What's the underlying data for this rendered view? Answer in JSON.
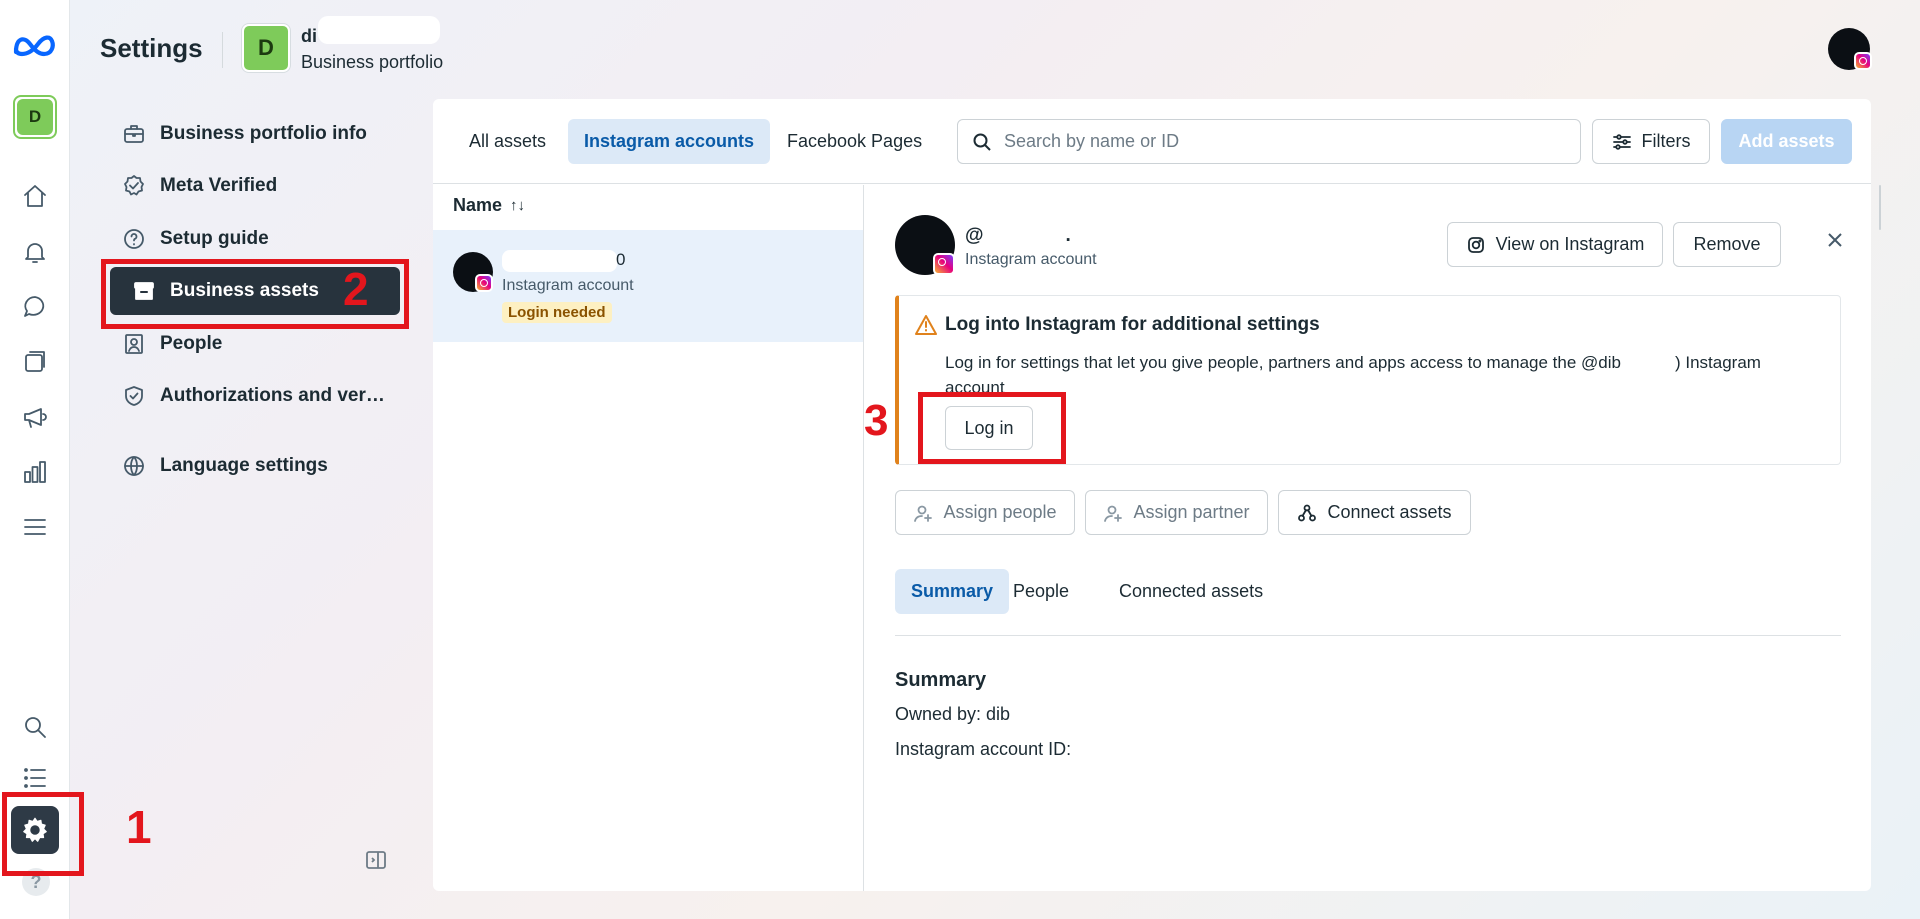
{
  "app": {
    "title": "Settings",
    "portfolio": {
      "initial": "D",
      "name": "di",
      "subtitle": "Business portfolio"
    }
  },
  "rail": {
    "items": [
      "meta-logo",
      "portfolio",
      "home",
      "notifications",
      "messages",
      "pages",
      "ads",
      "insights",
      "menu",
      "search",
      "list",
      "settings",
      "help"
    ],
    "help_label": "?"
  },
  "sidebar": {
    "items": [
      {
        "label": "Business portfolio info",
        "icon": "briefcase-icon"
      },
      {
        "label": "Meta Verified",
        "icon": "verified-badge-icon"
      },
      {
        "label": "Setup guide",
        "icon": "question-circle-icon"
      },
      {
        "label": "Business assets",
        "icon": "archive-box-icon",
        "active": true
      },
      {
        "label": "People",
        "icon": "people-icon"
      },
      {
        "label": "Authorizations and ver…",
        "icon": "shield-check-icon"
      },
      {
        "label": "Language settings",
        "icon": "globe-icon"
      }
    ]
  },
  "tabs": {
    "all_assets": "All assets",
    "instagram_accounts": "Instagram accounts",
    "facebook_pages": "Facebook Pages",
    "active": "Instagram accounts"
  },
  "search": {
    "placeholder": "Search by name or ID",
    "value": ""
  },
  "toolbar": {
    "filters": "Filters",
    "add_assets": "Add assets"
  },
  "list": {
    "header": "Name",
    "sort_icon": "↑↓",
    "rows": [
      {
        "title_suffix": "0",
        "type": "Instagram account",
        "badge": "Login needed"
      }
    ]
  },
  "detail": {
    "handle": "@",
    "handle_suffix": ".",
    "type": "Instagram account",
    "view_on_instagram": "View on Instagram",
    "remove": "Remove",
    "notice": {
      "title": "Log into Instagram for additional settings",
      "body_part1": "Log in for settings that let you give people, partners and apps access to manage the @dib",
      "body_part2": ") Instagram account",
      "login_button": "Log in"
    },
    "actions": {
      "assign_people": "Assign people",
      "assign_partner": "Assign partner",
      "connect_assets": "Connect assets"
    },
    "tabs": {
      "summary": "Summary",
      "people": "People",
      "connected_assets": "Connected assets"
    },
    "summary": {
      "title": "Summary",
      "owned_by": "Owned by: dib",
      "account_id": "Instagram account ID: "
    }
  },
  "annotations": {
    "step1": "1",
    "step2": "2",
    "step3": "3"
  },
  "colors": {
    "annotation_red": "#e3161d",
    "active_tab_bg": "#dce9f7",
    "active_tab_text": "#0a5ba8",
    "active_sidebar_bg": "#27333d",
    "warning_orange": "#e0821c",
    "portfolio_green": "#7ecb5a",
    "meta_blue": "#0866ff"
  }
}
